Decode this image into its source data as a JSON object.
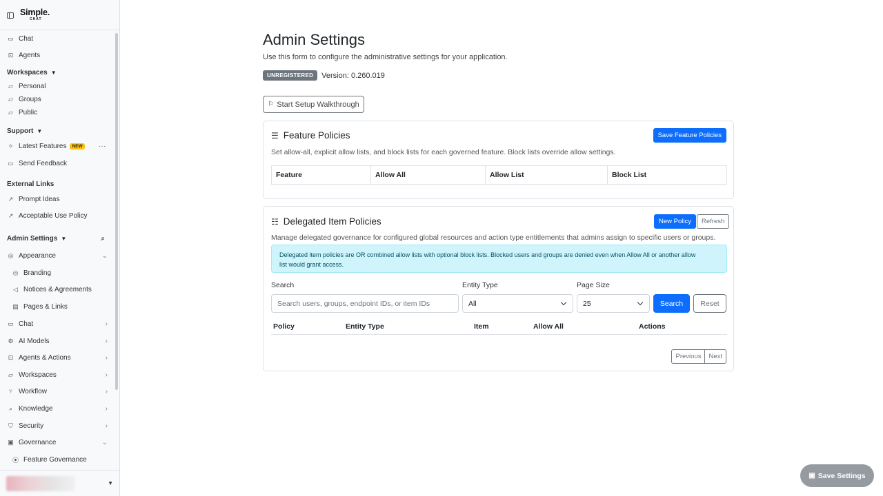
{
  "brand": {
    "line1": "Simple.",
    "line2": "CHAT"
  },
  "sidebar": {
    "chat": "Chat",
    "agents": "Agents",
    "workspaces": {
      "label": "Workspaces",
      "items": [
        "Personal",
        "Groups",
        "Public"
      ]
    },
    "support": {
      "label": "Support",
      "latest_features": "Latest Features",
      "new_badge": "NEW",
      "send_feedback": "Send Feedback"
    },
    "external_links": {
      "label": "External Links",
      "items": [
        "Prompt Ideas",
        "Acceptable Use Policy"
      ]
    },
    "admin_settings": {
      "label": "Admin Settings",
      "appearance": "Appearance",
      "appearance_items": [
        "Branding",
        "Notices & Agreements",
        "Pages & Links"
      ],
      "sections": [
        "Chat",
        "AI Models",
        "Agents & Actions",
        "Workspaces",
        "Workflow",
        "Knowledge",
        "Security"
      ],
      "governance": "Governance",
      "governance_items": [
        "Feature Governance"
      ]
    }
  },
  "page": {
    "title": "Admin Settings",
    "subtitle": "Use this form to configure the administrative settings for your application.",
    "status_badge": "UNREGISTERED",
    "version": "Version: 0.260.019",
    "walkthrough_button": "Start Setup Walkthrough"
  },
  "feature_policies": {
    "title": "Feature Policies",
    "description": "Set allow-all, explicit allow lists, and block lists for each governed feature. Block lists override allow settings.",
    "save_button": "Save Feature Policies",
    "columns": [
      "Feature",
      "Allow All",
      "Allow List",
      "Block List"
    ]
  },
  "delegated": {
    "title": "Delegated Item Policies",
    "description": "Manage delegated governance for configured global resources and action type entitlements that admins assign to specific users or groups.",
    "new_button": "New Policy",
    "refresh_button": "Refresh",
    "alert_line1": "Delegated item policies are OR combined allow lists with optional block lists. Blocked users and groups are denied even when Allow All or another allow",
    "alert_line2": "list would grant access.",
    "search_label": "Search",
    "search_placeholder": "Search users, groups, endpoint IDs, or item IDs",
    "entity_type_label": "Entity Type",
    "entity_type_value": "All",
    "page_size_label": "Page Size",
    "page_size_value": "25",
    "search_button": "Search",
    "reset_button": "Reset",
    "columns": [
      "Policy",
      "Entity Type",
      "Item",
      "Allow All",
      "Actions"
    ],
    "previous": "Previous",
    "next": "Next"
  },
  "save_settings": "Save Settings"
}
